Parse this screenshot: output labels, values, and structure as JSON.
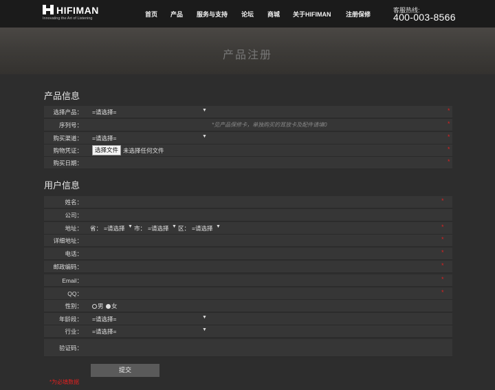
{
  "header": {
    "logo_text": "HIFIMAN",
    "logo_tagline": "Innovating the Art of Listening",
    "nav": [
      "首页",
      "产品",
      "服务与支持",
      "论坛",
      "商城",
      "关于HIFIMAN",
      "注册保修"
    ],
    "hotline_label": "客服热线:",
    "hotline_number": "400-003-8566"
  },
  "banner": {
    "title": "产品注册"
  },
  "product_section": {
    "title": "产品信息",
    "rows": [
      {
        "label": "选择产品：",
        "value": "=请选择=",
        "select": true
      },
      {
        "label": "序列号：",
        "hint": "*见产品保修卡，单独购买的耳放卡及配件请填0"
      },
      {
        "label": "购买渠道：",
        "value": "=请选择=",
        "select": true
      },
      {
        "label": "购物凭证：",
        "file_button": "选择文件",
        "file_text": "未选择任何文件"
      },
      {
        "label": "购买日期："
      }
    ]
  },
  "user_section": {
    "title": "用户信息",
    "rows": [
      {
        "label": "姓名：",
        "required": true
      },
      {
        "label": "公司：",
        "required": false
      },
      {
        "label": "地址：",
        "address": {
          "province_label": "省：",
          "province_value": "=请选择",
          "city_label": "市：",
          "city_value": "=请选择",
          "district_label": "区：",
          "district_value": "=请选择"
        },
        "required": true
      },
      {
        "label": "详细地址：",
        "required": true
      },
      {
        "label": "电话：",
        "required": true
      },
      {
        "label": "邮政编码：",
        "required": true
      },
      {
        "label": "Email：",
        "required": true
      },
      {
        "label": "QQ：",
        "required": true
      },
      {
        "label": "性别：",
        "gender": {
          "male": "男",
          "female": "女",
          "selected": "female"
        }
      },
      {
        "label": "年龄段：",
        "value": "=请选择=",
        "select": true
      },
      {
        "label": "行业：",
        "value": "=请选择=",
        "select": true
      },
      {
        "label": "验证码："
      }
    ]
  },
  "required_mark": "*",
  "submit_label": "提交",
  "footnote": "*为必填数据",
  "colors": {
    "required": "#e02020",
    "row_bg": "#363636",
    "page_bg": "#2d2d2d",
    "header_bg": "#1b1b1b"
  }
}
